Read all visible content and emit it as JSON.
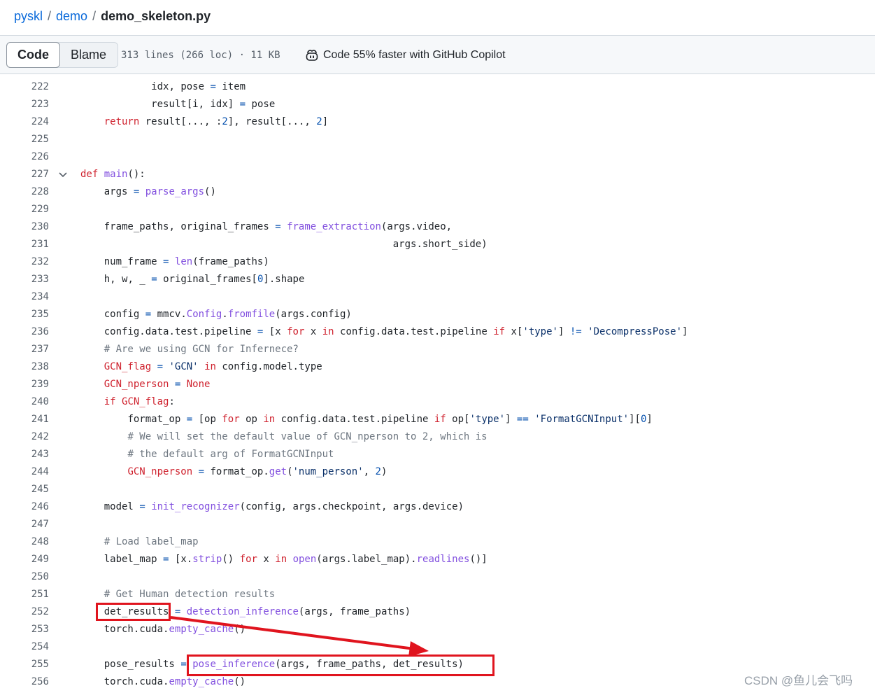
{
  "breadcrumb": {
    "repo": "pyskl",
    "sep1": "/",
    "folder": "demo",
    "sep2": "/",
    "file": "demo_skeleton.py"
  },
  "toolbar": {
    "code_label": "Code",
    "blame_label": "Blame",
    "file_info": "313 lines (266 loc) · 11 KB",
    "copilot_text": "Code 55% faster with GitHub Copilot",
    "copilot_icon": "copilot-icon"
  },
  "code_lines": [
    {
      "n": "222",
      "t": "            idx, pose = item"
    },
    {
      "n": "223",
      "t": "            result[i, idx] = pose"
    },
    {
      "n": "224",
      "t": "    return result[..., :2], result[..., 2]"
    },
    {
      "n": "225",
      "t": ""
    },
    {
      "n": "226",
      "t": ""
    },
    {
      "n": "227",
      "t": "def main():",
      "fold": true
    },
    {
      "n": "228",
      "t": "    args = parse_args()"
    },
    {
      "n": "229",
      "t": ""
    },
    {
      "n": "230",
      "t": "    frame_paths, original_frames = frame_extraction(args.video,"
    },
    {
      "n": "231",
      "t": "                                                     args.short_side)"
    },
    {
      "n": "232",
      "t": "    num_frame = len(frame_paths)"
    },
    {
      "n": "233",
      "t": "    h, w, _ = original_frames[0].shape"
    },
    {
      "n": "234",
      "t": ""
    },
    {
      "n": "235",
      "t": "    config = mmcv.Config.fromfile(args.config)"
    },
    {
      "n": "236",
      "t": "    config.data.test.pipeline = [x for x in config.data.test.pipeline if x['type'] != 'DecompressPose']"
    },
    {
      "n": "237",
      "t": "    # Are we using GCN for Infernece?"
    },
    {
      "n": "238",
      "t": "    GCN_flag = 'GCN' in config.model.type"
    },
    {
      "n": "239",
      "t": "    GCN_nperson = None"
    },
    {
      "n": "240",
      "t": "    if GCN_flag:"
    },
    {
      "n": "241",
      "t": "        format_op = [op for op in config.data.test.pipeline if op['type'] == 'FormatGCNInput'][0]"
    },
    {
      "n": "242",
      "t": "        # We will set the default value of GCN_nperson to 2, which is"
    },
    {
      "n": "243",
      "t": "        # the default arg of FormatGCNInput"
    },
    {
      "n": "244",
      "t": "        GCN_nperson = format_op.get('num_person', 2)"
    },
    {
      "n": "245",
      "t": ""
    },
    {
      "n": "246",
      "t": "    model = init_recognizer(config, args.checkpoint, args.device)"
    },
    {
      "n": "247",
      "t": ""
    },
    {
      "n": "248",
      "t": "    # Load label_map"
    },
    {
      "n": "249",
      "t": "    label_map = [x.strip() for x in open(args.label_map).readlines()]"
    },
    {
      "n": "250",
      "t": ""
    },
    {
      "n": "251",
      "t": "    # Get Human detection results"
    },
    {
      "n": "252",
      "t": "    det_results = detection_inference(args, frame_paths)"
    },
    {
      "n": "253",
      "t": "    torch.cuda.empty_cache()"
    },
    {
      "n": "254",
      "t": ""
    },
    {
      "n": "255",
      "t": "    pose_results = pose_inference(args, frame_paths, det_results)"
    },
    {
      "n": "256",
      "t": "    torch.cuda.empty_cache()"
    }
  ],
  "annotation": {
    "color": "#e0141e"
  },
  "watermark": "CSDN @鱼儿会飞吗"
}
